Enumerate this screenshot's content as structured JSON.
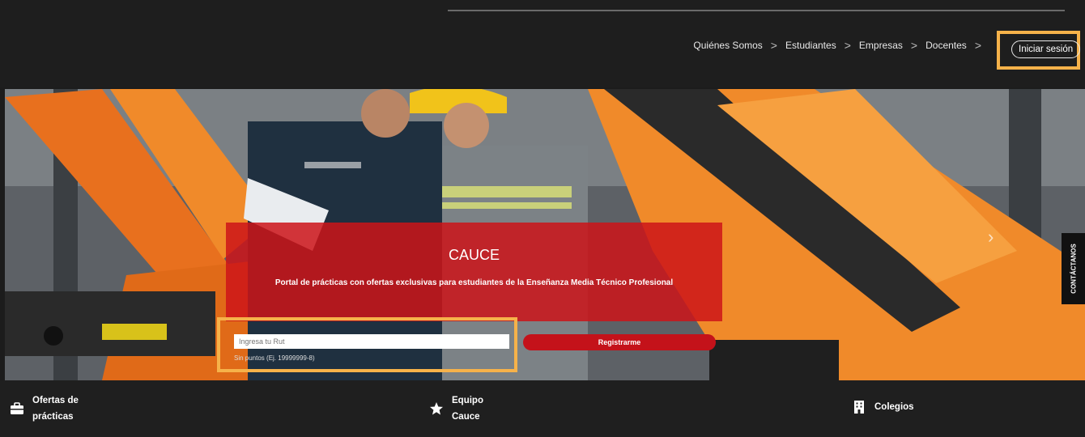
{
  "nav": {
    "items": [
      "Quiénes Somos",
      "Estudiantes",
      "Empresas",
      "Docentes"
    ],
    "separator": ">",
    "login_label": "Iniciar sesión"
  },
  "hero": {
    "title": "CAUCE",
    "subtitle": "Portal de prácticas con ofertas exclusivas para estudiantes de la Enseñanza Media Técnico Profesional",
    "rut_placeholder": "Ingresa tu Rut",
    "rut_hint": "Sin puntos (Ej. 19999999-8)",
    "register_label": "Registrarme",
    "next_arrow": "›",
    "contact_label": "CONTÁCTANOS"
  },
  "features": [
    {
      "icon": "briefcase-icon",
      "line1": "Ofertas de",
      "line2": "prácticas"
    },
    {
      "icon": "star-icon",
      "line1": "Equipo",
      "line2": "Cauce"
    },
    {
      "icon": "building-icon",
      "line1": "Colegios",
      "line2": ""
    }
  ],
  "colors": {
    "accent_red": "#c4121a",
    "highlight": "#f6b24a",
    "dark_bg": "#1e1e1e"
  }
}
